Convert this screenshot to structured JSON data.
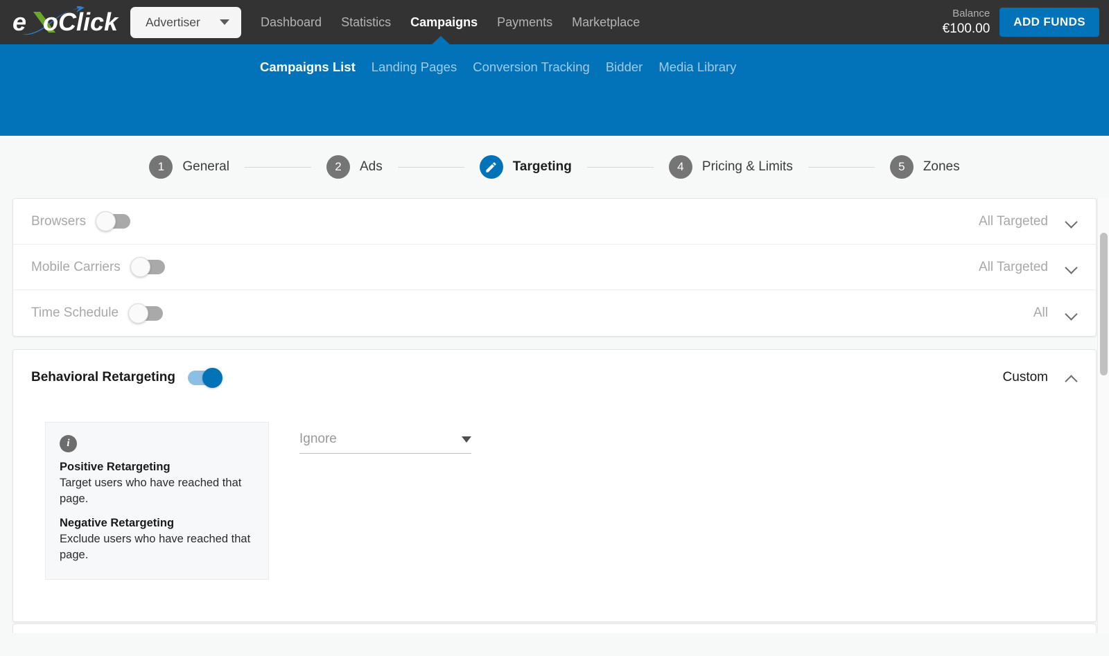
{
  "brand": {
    "logo_text": "exoClick",
    "accent_blue": "#0273b9",
    "accent_green": "#6aa82a",
    "topbar_bg": "#333333"
  },
  "topbar": {
    "account_selector": "Advertiser",
    "nav": [
      {
        "label": "Dashboard",
        "active": false
      },
      {
        "label": "Statistics",
        "active": false
      },
      {
        "label": "Campaigns",
        "active": true
      },
      {
        "label": "Payments",
        "active": false
      },
      {
        "label": "Marketplace",
        "active": false
      }
    ],
    "balance_label": "Balance",
    "balance_value": "€100.00",
    "add_funds_label": "ADD FUNDS"
  },
  "subnav": [
    {
      "label": "Campaigns List",
      "active": true
    },
    {
      "label": "Landing Pages",
      "active": false
    },
    {
      "label": "Conversion Tracking",
      "active": false
    },
    {
      "label": "Bidder",
      "active": false
    },
    {
      "label": "Media Library",
      "active": false
    }
  ],
  "stepper": [
    {
      "number": "1",
      "label": "General",
      "active": false
    },
    {
      "number": "2",
      "label": "Ads",
      "active": false
    },
    {
      "number": "3",
      "label": "Targeting",
      "active": true,
      "icon": "pencil-icon"
    },
    {
      "number": "4",
      "label": "Pricing & Limits",
      "active": false
    },
    {
      "number": "5",
      "label": "Zones",
      "active": false
    }
  ],
  "targeting_rows": [
    {
      "label": "Browsers",
      "value": "All Targeted",
      "toggle_on": false,
      "expanded": false
    },
    {
      "label": "Mobile Carriers",
      "value": "All Targeted",
      "toggle_on": false,
      "expanded": false
    },
    {
      "label": "Time Schedule",
      "value": "All",
      "toggle_on": false,
      "expanded": false
    }
  ],
  "behavioral": {
    "label": "Behavioral Retargeting",
    "value": "Custom",
    "toggle_on": true,
    "expanded": true,
    "info": {
      "icon": "info-icon",
      "positive_title": "Positive Retargeting",
      "positive_text": "Target users who have reached that page.",
      "negative_title": "Negative Retargeting",
      "negative_text": "Exclude users who have reached that page."
    },
    "select": {
      "placeholder": "Ignore",
      "value": ""
    }
  }
}
